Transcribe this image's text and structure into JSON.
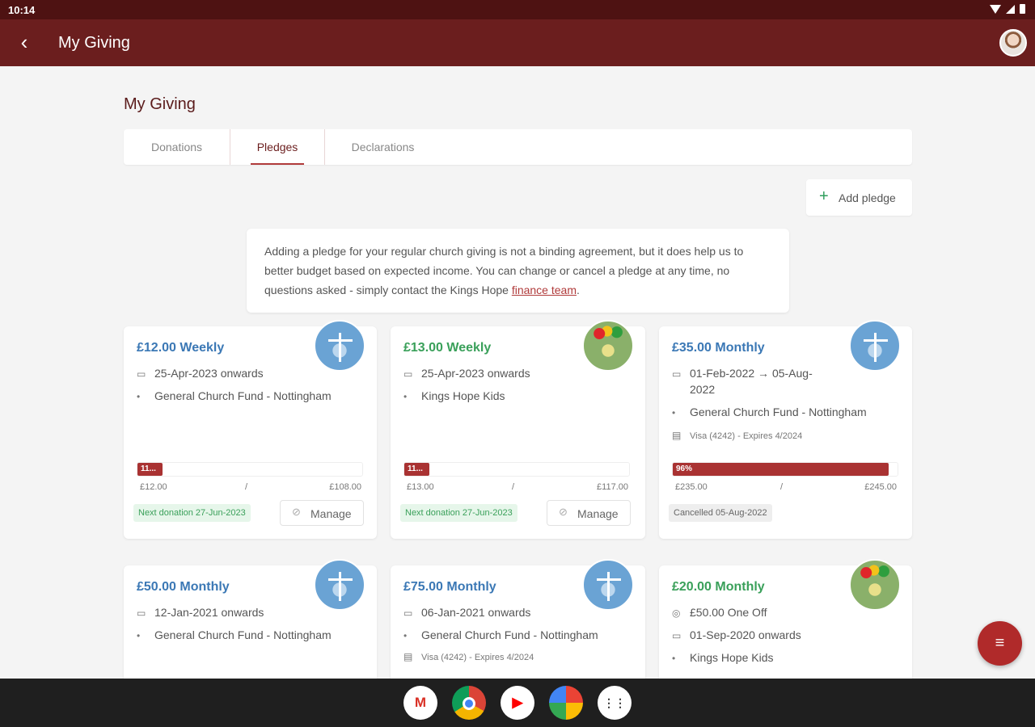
{
  "status": {
    "time": "10:14"
  },
  "appbar": {
    "title": "My Giving"
  },
  "page": {
    "title": "My Giving"
  },
  "tabs": [
    {
      "label": "Donations"
    },
    {
      "label": "Pledges"
    },
    {
      "label": "Declarations"
    }
  ],
  "add_pledge": {
    "label": "Add pledge"
  },
  "info": {
    "text": "Adding a pledge for your regular church giving is not a binding agreement, but it does help us to better budget based on expected income. You can change or cancel a pledge at any time, no questions asked - simply contact the Kings Hope ",
    "link": "finance team",
    "end": "."
  },
  "cards": [
    {
      "amount": "£12.00 Weekly",
      "date": "25-Apr-2023 onwards",
      "fund": "General Church Fund - Nottingham",
      "progress_label": "11...",
      "progress": 0.11,
      "range_from": "£12.00",
      "range_sep": "/",
      "range_to": "£108.00",
      "badge": "Next donation 27-Jun-2023",
      "manage": "Manage"
    },
    {
      "amount": "£13.00 Weekly",
      "date": "25-Apr-2023 onwards",
      "fund": "Kings Hope Kids",
      "progress_label": "11...",
      "progress": 0.11,
      "range_from": "£13.00",
      "range_sep": "/",
      "range_to": "£117.00",
      "badge": "Next donation 27-Jun-2023",
      "manage": "Manage"
    },
    {
      "amount": "£35.00 Monthly",
      "date_line1": "01-Feb-2022 → 05-Aug-",
      "date_line2": "2022",
      "fund": "General Church Fund - Nottingham",
      "card_info": "Visa (4242) - Expires 4/2024",
      "progress_label": "96%",
      "progress": 0.96,
      "range_from": "£235.00",
      "range_sep": "/",
      "range_to": "£245.00",
      "badge": "Cancelled 05-Aug-2022"
    },
    {
      "amount": "£50.00 Monthly",
      "date": "12-Jan-2021 onwards",
      "fund": "General Church Fund - Nottingham"
    },
    {
      "amount": "£75.00 Monthly",
      "date": "06-Jan-2021 onwards",
      "fund": "General Church Fund - Nottingham",
      "card_info": "Visa (4242) - Expires 4/2024"
    },
    {
      "amount": "£20.00 Monthly",
      "one_off": "£50.00 One Off",
      "date": "01-Sep-2020 onwards",
      "fund": "Kings Hope Kids"
    }
  ],
  "colors": {
    "appbar": "#6b1e1e",
    "accent": "#b03a3a",
    "blue_amount": "#3b78b5",
    "green_amount": "#3aa05a"
  },
  "dock": [
    "gmail-icon",
    "chrome-icon",
    "youtube-icon",
    "photos-icon",
    "app-drawer-icon"
  ]
}
